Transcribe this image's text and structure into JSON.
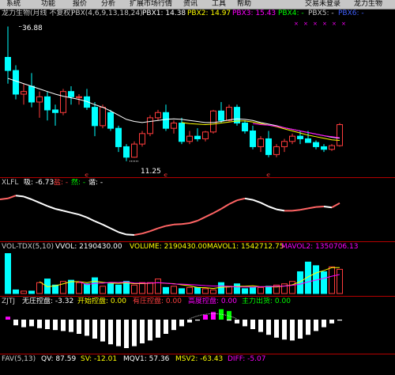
{
  "menu": {
    "items": [
      "系统",
      "功能",
      "报价",
      "分析",
      "扩展市场行情",
      "资讯",
      "工具",
      "帮助"
    ],
    "right_items": [
      "交易未登录",
      "龙力生物"
    ]
  },
  "kline": {
    "header": [
      {
        "text": "龙力生物(月线 不复权)",
        "color": "#c8c8c8"
      },
      {
        "text": "PBX(4,6,9,13,18,24)",
        "color": "#c8c8c8"
      },
      {
        "text": "PBX1: 14.38",
        "color": "#ffffff"
      },
      {
        "text": "PBX2: 14.97",
        "color": "#ffff00"
      },
      {
        "text": "PBX3: 15.43",
        "color": "#ff00ff"
      },
      {
        "text": "PBX4: -",
        "color": "#00ff00"
      },
      {
        "text": "PBX5: -",
        "color": "#c8c8c8"
      },
      {
        "text": "PBX6: -",
        "color": "#4060ff"
      }
    ],
    "high_label": "36.88",
    "low_label": "11.25",
    "s_marks": [
      "S",
      "S",
      "S"
    ],
    "candles": [
      [
        31,
        36.88,
        26,
        28.5
      ],
      [
        28.5,
        29.5,
        23,
        24
      ],
      [
        24,
        26,
        22,
        24.5
      ],
      [
        25.5,
        28,
        21.5,
        22.5
      ],
      [
        22.5,
        24.5,
        19.5,
        23.5
      ],
      [
        23.5,
        24.5,
        19,
        21
      ],
      [
        21,
        22,
        18,
        20.5
      ],
      [
        20.5,
        25,
        20,
        24.5
      ],
      [
        24.5,
        25.5,
        22,
        23.5
      ],
      [
        23.5,
        24,
        22,
        23.5
      ],
      [
        23.5,
        25,
        21,
        21.5
      ],
      [
        21.5,
        22.5,
        16,
        18
      ],
      [
        18,
        22,
        17.5,
        21.5
      ],
      [
        20.5,
        21,
        17,
        17.5
      ],
      [
        17.5,
        18,
        13,
        14
      ],
      [
        14,
        14.5,
        11.25,
        12
      ],
      [
        12,
        15,
        11.9,
        14.5
      ],
      [
        14.5,
        17,
        14,
        16.5
      ],
      [
        16.5,
        20,
        16,
        19.5
      ],
      [
        19.5,
        21,
        19,
        20.5
      ],
      [
        20.5,
        22,
        17,
        17.5
      ],
      [
        17.5,
        19,
        16.5,
        18.5
      ],
      [
        18.5,
        19.5,
        14.5,
        15
      ],
      [
        15,
        17,
        14.5,
        16
      ],
      [
        16,
        17.5,
        15,
        15.5
      ],
      [
        15.5,
        17,
        15,
        16.8
      ],
      [
        16.8,
        21,
        16.5,
        20.8
      ],
      [
        20.8,
        22.5,
        18.5,
        19
      ],
      [
        19,
        22,
        18.8,
        21.5
      ],
      [
        21.5,
        22,
        18,
        18.5
      ],
      [
        18.5,
        19,
        16.5,
        17
      ],
      [
        17,
        18,
        13.5,
        14
      ],
      [
        14,
        16,
        13,
        15.5
      ],
      [
        15.5,
        17,
        12,
        12.5
      ],
      [
        12.5,
        14.5,
        12,
        14
      ],
      [
        14,
        15.5,
        13,
        15
      ],
      [
        15,
        16.5,
        14.5,
        16
      ],
      [
        16,
        17,
        14.5,
        15.5
      ],
      [
        15.5,
        17,
        14.8,
        14.8
      ],
      [
        14.8,
        15.2,
        13.5,
        14
      ],
      [
        14,
        14.5,
        13,
        13.5
      ],
      [
        13.5,
        14.5,
        13.2,
        14.2
      ],
      [
        14.2,
        18.5,
        14,
        18.2
      ]
    ],
    "ma1": [
      27,
      26.5,
      26,
      25.5,
      25,
      24.5,
      24,
      23.6,
      23.3,
      23,
      22.6,
      22,
      21.5,
      20.8,
      20,
      19.2,
      18.8,
      18.6,
      18.8,
      19,
      19.2,
      19.3,
      19.2,
      19,
      18.8,
      18.6,
      18.6,
      18.8,
      19.1,
      19.3,
      19.2,
      19,
      18.6,
      18.3,
      18,
      17.6,
      17.3,
      17,
      16.7,
      16.4,
      16.1,
      15.8,
      15.6
    ],
    "ma2": [
      null,
      null,
      null,
      null,
      null,
      null,
      null,
      null,
      null,
      null,
      null,
      null,
      null,
      null,
      null,
      null,
      null,
      null,
      null,
      null,
      null,
      null,
      18.6,
      18.4,
      18.3,
      18.2,
      18.3,
      18.5,
      18.7,
      18.9,
      18.9,
      18.7,
      18.4,
      18.1,
      17.8,
      17.4,
      17,
      16.6,
      16.2,
      15.9,
      15.6,
      15.3,
      15.2
    ],
    "ma3": [
      null,
      null,
      null,
      null,
      null,
      null,
      null,
      null,
      null,
      null,
      null,
      null,
      null,
      null,
      null,
      null,
      null,
      null,
      null,
      null,
      null,
      null,
      null,
      null,
      null,
      null,
      null,
      null,
      null,
      null,
      null,
      18.4,
      18.2,
      18.1,
      17.9,
      17.6,
      17.3,
      17,
      16.7,
      16.4,
      16.1,
      15.9,
      15.7
    ]
  },
  "xlfl": {
    "header": [
      {
        "text": "XLFL",
        "color": "#c8c8c8"
      },
      {
        "text": "吸: -6.73",
        "color": "#ffffff"
      },
      {
        "text": "盐: -",
        "color": "#ff4040"
      },
      {
        "text": "然: -",
        "color": "#00ff00"
      },
      {
        "text": "谐: -",
        "color": "#ffffff"
      }
    ],
    "values": [
      0.82,
      0.88,
      0.86,
      0.8,
      0.73,
      0.66,
      0.6,
      0.56,
      0.52,
      0.48,
      0.42,
      0.34,
      0.27,
      0.19,
      0.11,
      0.06,
      0.05,
      0.08,
      0.13,
      0.19,
      0.24,
      0.27,
      0.28,
      0.3,
      0.35,
      0.43,
      0.51,
      0.6,
      0.7,
      0.78,
      0.82,
      0.79,
      0.73,
      0.65,
      0.59,
      0.56,
      0.56,
      0.58,
      0.61,
      0.64,
      0.65,
      0.63,
      0.72
    ]
  },
  "volume": {
    "header": [
      {
        "text": "VOL-TDX(5,10)",
        "color": "#c8c8c8"
      },
      {
        "text": "VVOL: 2190430.00",
        "color": "#ffffff"
      },
      {
        "text": "VOLUME: 2190430.00",
        "color": "#ffff00"
      },
      {
        "text": "MAVOL1: 1542712.75",
        "color": "#ffff00"
      },
      {
        "text": "MAVOL2: 1350706.13",
        "color": "#ff00ff"
      }
    ],
    "values": [
      3.3,
      0.3,
      0.2,
      0.2,
      0.9,
      1.2,
      0.7,
      1.0,
      1.1,
      0.9,
      0.8,
      1.3,
      0.6,
      0.8,
      0.7,
      1.0,
      0.7,
      0.9,
      0.9,
      1.2,
      0.5,
      0.6,
      0.4,
      0.5,
      0.5,
      0.4,
      0.3,
      0.9,
      0.6,
      0.8,
      0.4,
      0.5,
      0.5,
      0.6,
      0.7,
      0.8,
      1.0,
      1.8,
      2.6,
      2.3,
      1.8,
      2.2,
      2.0
    ],
    "ma1": [
      null,
      null,
      null,
      null,
      0.98,
      0.56,
      0.64,
      0.8,
      0.98,
      0.98,
      0.9,
      1.02,
      0.92,
      0.86,
      0.84,
      0.88,
      0.82,
      0.82,
      0.84,
      0.9,
      0.84,
      0.82,
      0.72,
      0.64,
      0.5,
      0.48,
      0.42,
      0.52,
      0.54,
      0.6,
      0.6,
      0.64,
      0.56,
      0.56,
      0.54,
      0.62,
      0.72,
      0.98,
      1.38,
      1.7,
      1.9,
      2.14,
      2.14
    ],
    "ma2": [
      null,
      null,
      null,
      null,
      null,
      null,
      null,
      null,
      null,
      0.98,
      0.74,
      0.84,
      0.86,
      0.92,
      0.91,
      0.95,
      0.87,
      0.86,
      0.86,
      0.89,
      0.86,
      0.79,
      0.78,
      0.74,
      0.7,
      0.65,
      0.62,
      0.62,
      0.59,
      0.55,
      0.54,
      0.53,
      0.56,
      0.57,
      0.6,
      0.61,
      0.68,
      0.77,
      0.96,
      1.11,
      1.25,
      1.43,
      1.57
    ]
  },
  "control": {
    "header": [
      {
        "text": "ZJTJ",
        "color": "#c8c8c8"
      },
      {
        "text": "无庄控盘: -3.32",
        "color": "#ffffff"
      },
      {
        "text": "开始控盘: 0.00",
        "color": "#ffff00"
      },
      {
        "text": "有庄控盘: 0.00",
        "color": "#ff4040"
      },
      {
        "text": "高度控盘: 0.00",
        "color": "#ff00ff"
      },
      {
        "text": "主力出货: 0.00",
        "color": "#00ff00"
      }
    ],
    "values": [
      0.3,
      -0.6,
      -0.8,
      -0.7,
      -0.9,
      -1.0,
      -1.1,
      -1.2,
      -1.3,
      -1.5,
      -1.7,
      -2.0,
      -2.3,
      -2.6,
      -2.8,
      -3.0,
      -2.8,
      -2.5,
      -2.2,
      -1.9,
      -1.5,
      -1.1,
      -0.7,
      -0.3,
      -0.1,
      0.2,
      0.4,
      0.3,
      -0.1,
      -0.4,
      -0.7,
      -1.0,
      -1.3,
      -1.6,
      -1.9,
      -2.1,
      -2.2,
      -2.0,
      -1.6,
      -1.2,
      -0.8,
      -0.4,
      -0.1
    ],
    "markers": [
      {
        "index": 0,
        "color": "#ff00ff",
        "value": 0.3
      },
      {
        "index": 25,
        "color": "#ff00ff",
        "value": 0.5
      },
      {
        "index": 26,
        "color": "#ff00ff",
        "value": 0.8
      },
      {
        "index": 27,
        "color": "#00ff00",
        "value": 1.1
      },
      {
        "index": 28,
        "color": "#00ff00",
        "value": 0.9
      }
    ]
  },
  "bottom": {
    "header": [
      {
        "text": "FAV(5,13)",
        "color": "#c8c8c8"
      },
      {
        "text": "QV: 87.59",
        "color": "#ffffff"
      },
      {
        "text": "SV: -12.01",
        "color": "#ffff00"
      },
      {
        "text": "MQV1: 57.36",
        "color": "#ffffff"
      },
      {
        "text": "MSV2: -63.43",
        "color": "#ffff00"
      },
      {
        "text": "DIFF: -5.07",
        "color": "#ff00ff"
      }
    ]
  }
}
